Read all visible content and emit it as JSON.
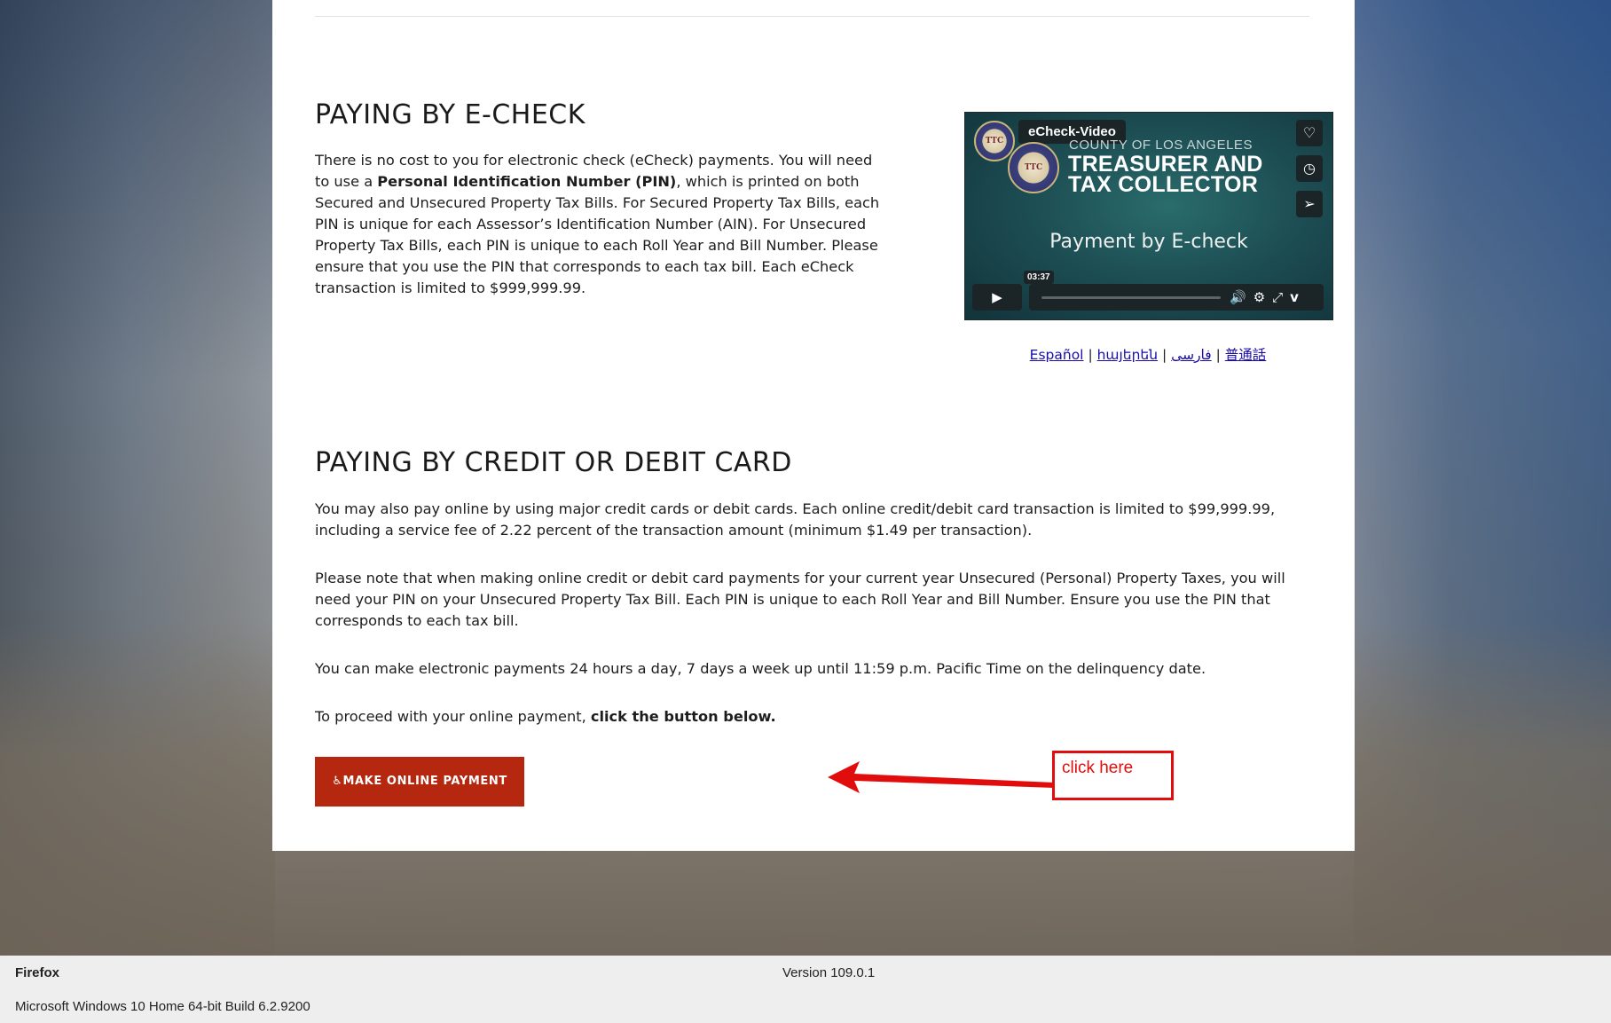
{
  "echeck": {
    "heading": "PAYING BY E-CHECK",
    "p1_a": "There is no cost to you for electronic check (eCheck) payments. You will need to use a ",
    "p1_bold": "Personal Identification Number (PIN)",
    "p1_b": ", which is printed on both Secured and Unsecured Property Tax Bills.  For Secured Property Tax Bills, each PIN is unique for each Assessor’s Identification Number (AIN). For Unsecured Property Tax Bills, each PIN is unique to each Roll Year and Bill Number. Please ensure that you use the PIN that corresponds to each tax bill. Each eCheck transaction is limited to $999,999.99."
  },
  "video": {
    "title": "eCheck-Video",
    "county_line": "COUNTY OF LOS ANGELES",
    "line1": "TREASURER AND",
    "line2": "TAX COLLECTOR",
    "subtitle": "Payment by E-check",
    "duration": "03:37",
    "seal_text": "TTC",
    "icons": [
      "heart-icon",
      "clock-icon",
      "send-icon",
      "play-icon",
      "volume-icon",
      "settings-icon",
      "fullscreen-icon",
      "vimeo-icon"
    ]
  },
  "languages": {
    "items": [
      "Español",
      "հայերեն",
      "فارسی",
      "普通話"
    ],
    "separator": "|"
  },
  "card_payment": {
    "heading": "PAYING BY CREDIT OR DEBIT CARD",
    "p1": "You may also pay online by using major credit cards or debit cards. Each online credit/debit card transaction is limited to $99,999.99, including a service fee of 2.22 percent of the transaction amount (minimum $1.49 per transaction).",
    "p2": "Please note that when making online credit or debit card payments for your current year Unsecured (Personal) Property Taxes, you will need your PIN on your Unsecured Property Tax Bill. Each PIN is unique to each Roll Year and Bill Number. Ensure you use the PIN that corresponds to each tax bill.",
    "p3": "You can make electronic payments 24 hours a day, 7 days a week up until 11:59 p.m. Pacific Time on the delinquency date.",
    "p4_a": "To proceed with your online payment, ",
    "p4_bold": "click the button below.",
    "button_label": "MAKE ONLINE PAYMENT",
    "button_color": "#b5270f"
  },
  "annotation": {
    "label": "click here",
    "color": "#e10d0d"
  },
  "system_bar": {
    "app": "Firefox",
    "version": "Version 109.0.1",
    "os": "Microsoft Windows 10 Home 64-bit Build 6.2.9200"
  }
}
